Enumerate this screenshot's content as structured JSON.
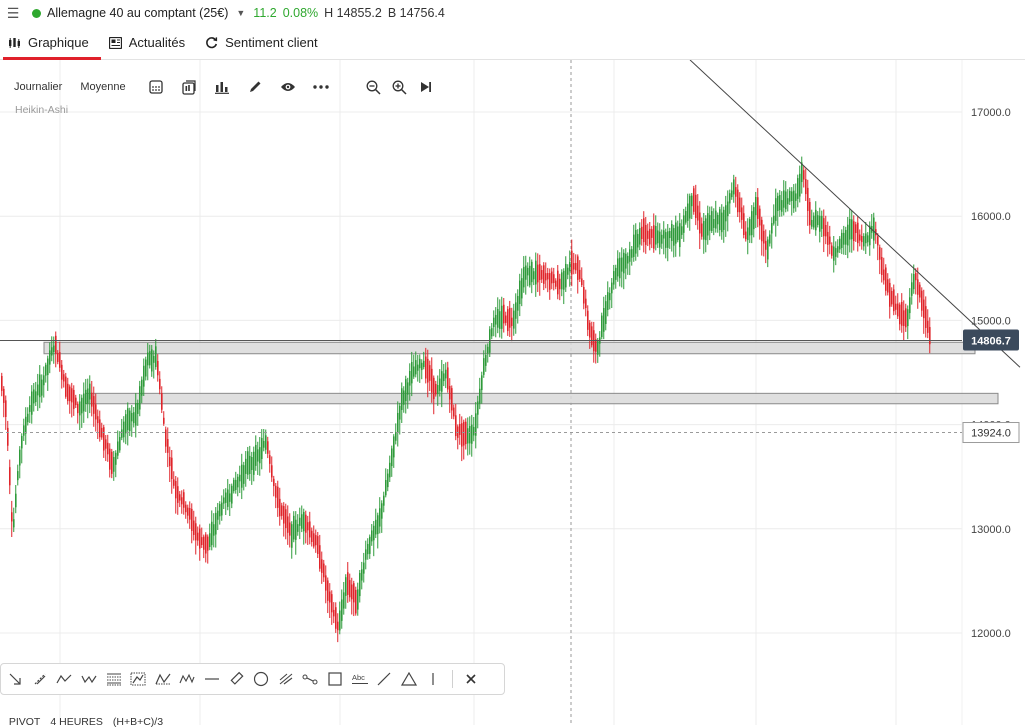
{
  "header": {
    "menu_icon": "hamburger-icon",
    "status_color": "#2fa82f",
    "instrument": "Allemagne 40 au comptant (25€)",
    "change": "11.2",
    "change_pct": "0.08%",
    "high": "H 14855.2",
    "low": "B 14756.4"
  },
  "tabs": [
    {
      "label": "Graphique",
      "icon": "chart-candles-icon",
      "active": true
    },
    {
      "label": "Actualités",
      "icon": "news-icon",
      "active": false
    },
    {
      "label": "Sentiment client",
      "icon": "refresh-sentiment-icon",
      "active": false
    }
  ],
  "toolbar": {
    "period": "Journalier",
    "indicator": "Moyenne",
    "icons": [
      "candle-type-icon",
      "layout-icon",
      "bar-chart-icon",
      "pencil-icon",
      "eye-icon",
      "more-icon",
      "zoom-out-icon",
      "zoom-in-icon",
      "skip-end-icon"
    ]
  },
  "chart_subtitle": "Heikin-Ashi",
  "chart_data": {
    "type": "candlestick",
    "style": "Heikin-Ashi",
    "period": "Journalier",
    "ylim": [
      11850,
      17450
    ],
    "y_ticks": [
      "17000.0",
      "16000.0",
      "15000.0",
      "14000.0",
      "13000.0",
      "12000.0"
    ],
    "y_tick_values": [
      17000,
      16000,
      15000,
      14000,
      13000,
      12000
    ],
    "up_color": "#2e9a3a",
    "down_color": "#e0242a",
    "grid": true,
    "current_price": {
      "value": 14806.7,
      "label": "14806.7"
    },
    "crosshair_price": {
      "value": 13924.0,
      "label": "13924.0"
    },
    "zones": [
      {
        "from": 14680,
        "to": 14790
      },
      {
        "from": 14200,
        "to": 14300
      }
    ],
    "trendline": [
      {
        "x": 690,
        "y": 17500
      },
      {
        "x": 1020,
        "y": 14550
      }
    ],
    "price_path": [
      {
        "x": 0,
        "y": 14450
      },
      {
        "x": 6,
        "y": 14100
      },
      {
        "x": 12,
        "y": 12950
      },
      {
        "x": 20,
        "y": 13800
      },
      {
        "x": 30,
        "y": 14200
      },
      {
        "x": 42,
        "y": 14400
      },
      {
        "x": 54,
        "y": 14780
      },
      {
        "x": 66,
        "y": 14350
      },
      {
        "x": 78,
        "y": 14150
      },
      {
        "x": 90,
        "y": 14300
      },
      {
        "x": 100,
        "y": 13950
      },
      {
        "x": 112,
        "y": 13600
      },
      {
        "x": 124,
        "y": 14000
      },
      {
        "x": 136,
        "y": 14100
      },
      {
        "x": 146,
        "y": 14600
      },
      {
        "x": 156,
        "y": 14650
      },
      {
        "x": 164,
        "y": 13950
      },
      {
        "x": 174,
        "y": 13400
      },
      {
        "x": 186,
        "y": 13200
      },
      {
        "x": 198,
        "y": 12900
      },
      {
        "x": 208,
        "y": 12850
      },
      {
        "x": 220,
        "y": 13200
      },
      {
        "x": 234,
        "y": 13400
      },
      {
        "x": 246,
        "y": 13600
      },
      {
        "x": 258,
        "y": 13700
      },
      {
        "x": 266,
        "y": 13850
      },
      {
        "x": 276,
        "y": 13300
      },
      {
        "x": 290,
        "y": 12950
      },
      {
        "x": 304,
        "y": 13100
      },
      {
        "x": 318,
        "y": 12800
      },
      {
        "x": 328,
        "y": 12350
      },
      {
        "x": 338,
        "y": 12050
      },
      {
        "x": 346,
        "y": 12500
      },
      {
        "x": 356,
        "y": 12300
      },
      {
        "x": 366,
        "y": 12800
      },
      {
        "x": 378,
        "y": 13050
      },
      {
        "x": 390,
        "y": 13600
      },
      {
        "x": 400,
        "y": 14200
      },
      {
        "x": 412,
        "y": 14500
      },
      {
        "x": 424,
        "y": 14600
      },
      {
        "x": 436,
        "y": 14300
      },
      {
        "x": 446,
        "y": 14500
      },
      {
        "x": 456,
        "y": 13950
      },
      {
        "x": 466,
        "y": 13900
      },
      {
        "x": 474,
        "y": 13950
      },
      {
        "x": 482,
        "y": 14500
      },
      {
        "x": 492,
        "y": 14950
      },
      {
        "x": 502,
        "y": 15050
      },
      {
        "x": 512,
        "y": 15000
      },
      {
        "x": 524,
        "y": 15450
      },
      {
        "x": 536,
        "y": 15450
      },
      {
        "x": 548,
        "y": 15400
      },
      {
        "x": 560,
        "y": 15350
      },
      {
        "x": 570,
        "y": 15550
      },
      {
        "x": 580,
        "y": 15450
      },
      {
        "x": 588,
        "y": 14950
      },
      {
        "x": 596,
        "y": 14700
      },
      {
        "x": 606,
        "y": 15150
      },
      {
        "x": 616,
        "y": 15500
      },
      {
        "x": 628,
        "y": 15600
      },
      {
        "x": 640,
        "y": 15850
      },
      {
        "x": 654,
        "y": 15800
      },
      {
        "x": 666,
        "y": 15800
      },
      {
        "x": 680,
        "y": 15850
      },
      {
        "x": 692,
        "y": 16200
      },
      {
        "x": 702,
        "y": 15850
      },
      {
        "x": 712,
        "y": 15950
      },
      {
        "x": 722,
        "y": 15950
      },
      {
        "x": 734,
        "y": 16300
      },
      {
        "x": 746,
        "y": 15800
      },
      {
        "x": 756,
        "y": 16100
      },
      {
        "x": 766,
        "y": 15650
      },
      {
        "x": 776,
        "y": 16100
      },
      {
        "x": 786,
        "y": 16150
      },
      {
        "x": 796,
        "y": 16200
      },
      {
        "x": 802,
        "y": 16450
      },
      {
        "x": 810,
        "y": 15950
      },
      {
        "x": 822,
        "y": 15950
      },
      {
        "x": 832,
        "y": 15650
      },
      {
        "x": 842,
        "y": 15750
      },
      {
        "x": 852,
        "y": 15900
      },
      {
        "x": 862,
        "y": 15750
      },
      {
        "x": 874,
        "y": 15900
      },
      {
        "x": 884,
        "y": 15400
      },
      {
        "x": 896,
        "y": 15100
      },
      {
        "x": 906,
        "y": 15000
      },
      {
        "x": 914,
        "y": 15450
      },
      {
        "x": 922,
        "y": 15150
      },
      {
        "x": 930,
        "y": 14810
      }
    ]
  },
  "draw_tools": [
    "arrow-diagonal-icon",
    "ray-icon",
    "zigzag-icon",
    "elliott-wave-icon",
    "fibonacci-icon",
    "gann-box-icon",
    "triangle-pattern-icon",
    "harmonic-pattern-icon",
    "horizontal-line-icon",
    "ruler-icon",
    "circle-icon",
    "pitchfork-icon",
    "node-line-icon",
    "rectangle-icon",
    "text-abc-icon",
    "trend-line-icon",
    "triangle-icon",
    "vertical-line-icon",
    "close-icon"
  ],
  "draw_tools_text": {
    "abc": "Abc"
  },
  "pivot_bar": {
    "label": "PIVOT",
    "period": "4 HEURES",
    "formula": "(H+B+C)/3"
  }
}
